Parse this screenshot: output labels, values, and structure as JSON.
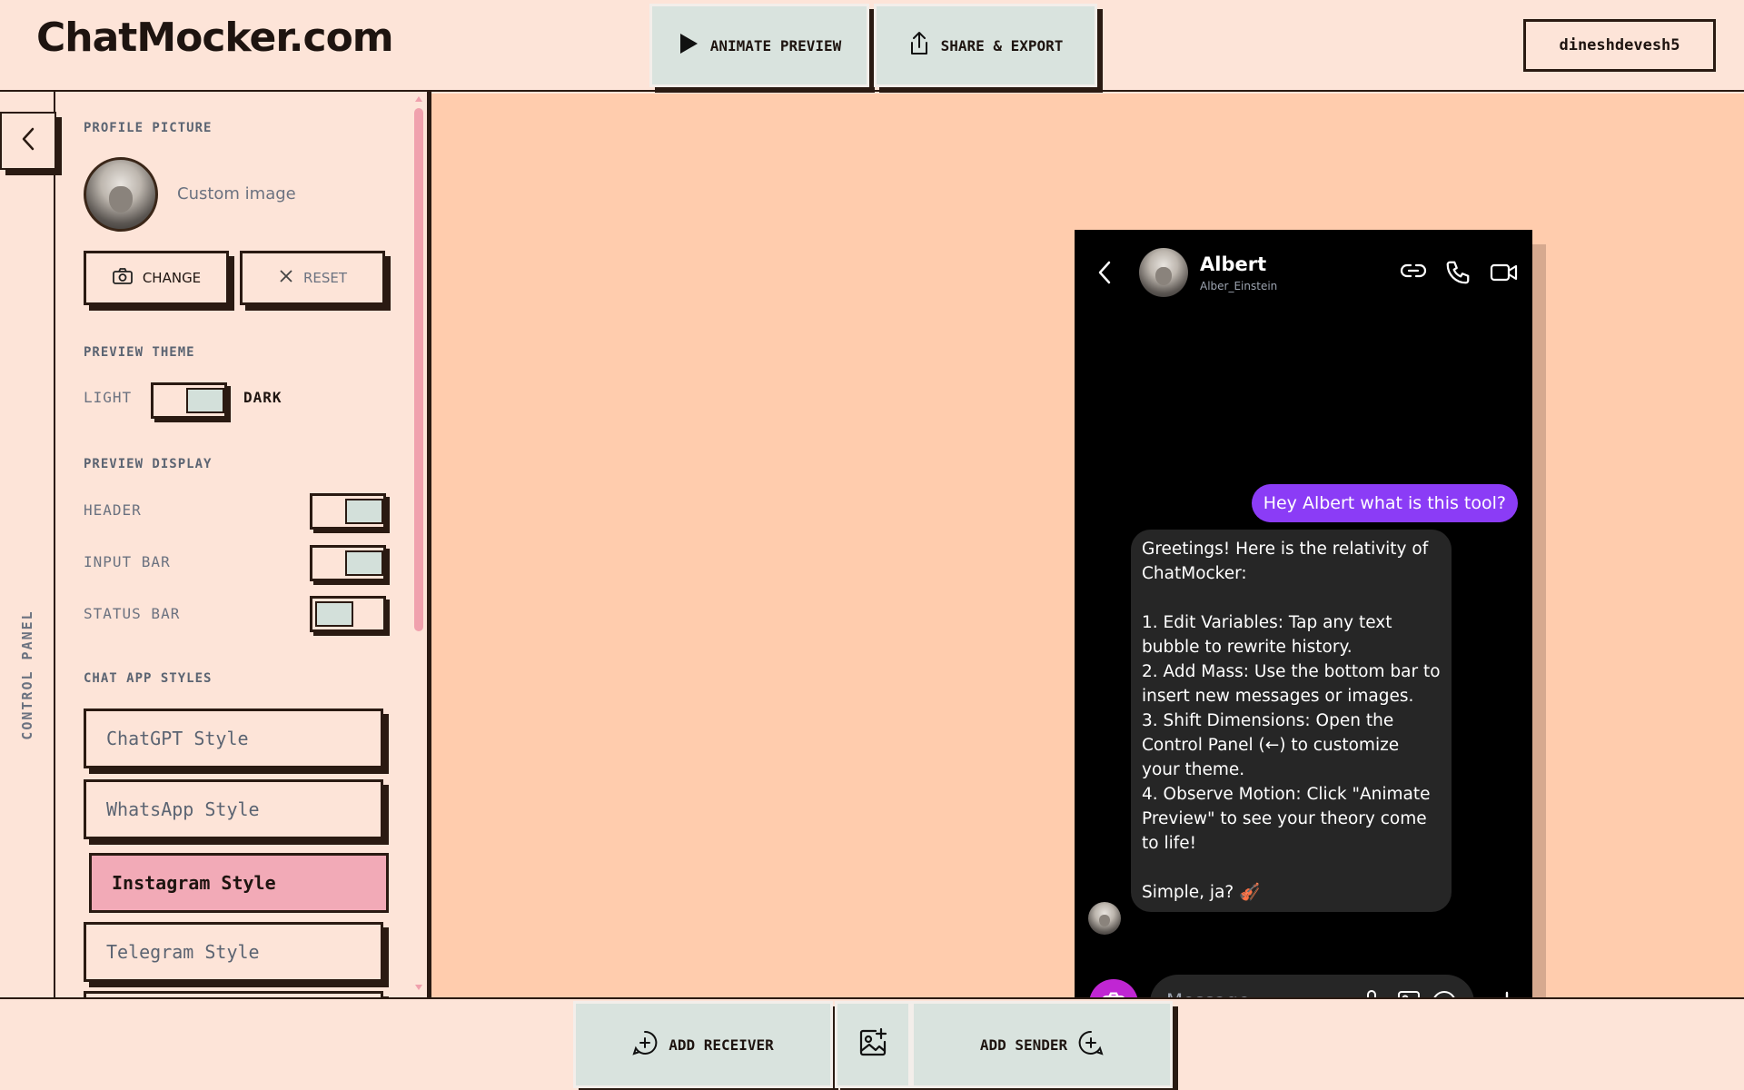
{
  "app": {
    "logo": "ChatMocker.com",
    "user": "dineshdevesh5"
  },
  "toolbar": {
    "animate_label": "ANIMATE PREVIEW",
    "share_label": "SHARE & EXPORT"
  },
  "rail": {
    "label": "CONTROL PANEL"
  },
  "panel": {
    "profile_title": "PROFILE PICTURE",
    "custom_image": "Custom image",
    "change_label": "CHANGE",
    "reset_label": "RESET",
    "theme_title": "PREVIEW THEME",
    "theme_light": "LIGHT",
    "theme_dark": "DARK",
    "theme_value": "dark",
    "display_title": "PREVIEW DISPLAY",
    "display_header": "HEADER",
    "display_input": "INPUT BAR",
    "display_status": "STATUS BAR",
    "display_values": {
      "header": true,
      "input_bar": true,
      "status_bar": false
    },
    "styles_title": "CHAT APP STYLES",
    "styles": [
      "ChatGPT Style",
      "WhatsApp Style",
      "Instagram Style",
      "Telegram Style"
    ],
    "selected_style": "Instagram Style"
  },
  "chat": {
    "name": "Albert",
    "handle": "Alber_Einstein",
    "outgoing": "Hey Albert what is this tool?",
    "incoming": "Greetings! Here is the relativity of ChatMocker:\n\n1. Edit Variables: Tap any text bubble to rewrite history.\n2. Add Mass: Use the bottom bar to insert new messages or images.\n3. Shift Dimensions: Open the Control Panel (←) to customize your theme.\n4. Observe Motion: Click \"Animate Preview\" to see your theory come to life!\n\nSimple, ja? 🎻",
    "input_placeholder": "Message..."
  },
  "bottom": {
    "add_receiver": "ADD RECEIVER",
    "add_sender": "ADD SENDER"
  },
  "colors": {
    "background": "#fde4d8",
    "preview_bg": "#ffccad",
    "button_bg": "#d9e3de",
    "accent_pink": "#f2aab7",
    "outgoing_bubble": "#8b3cf6",
    "incoming_bubble": "#262626",
    "camera_button": "#c026d3"
  },
  "icons": [
    "play-icon",
    "share-icon",
    "chevron-left-icon",
    "camera-icon",
    "close-icon",
    "link-icon",
    "phone-icon",
    "video-icon",
    "mic-icon",
    "image-icon",
    "emoji-icon",
    "plus-icon",
    "add-circle-icon",
    "add-image-icon"
  ]
}
